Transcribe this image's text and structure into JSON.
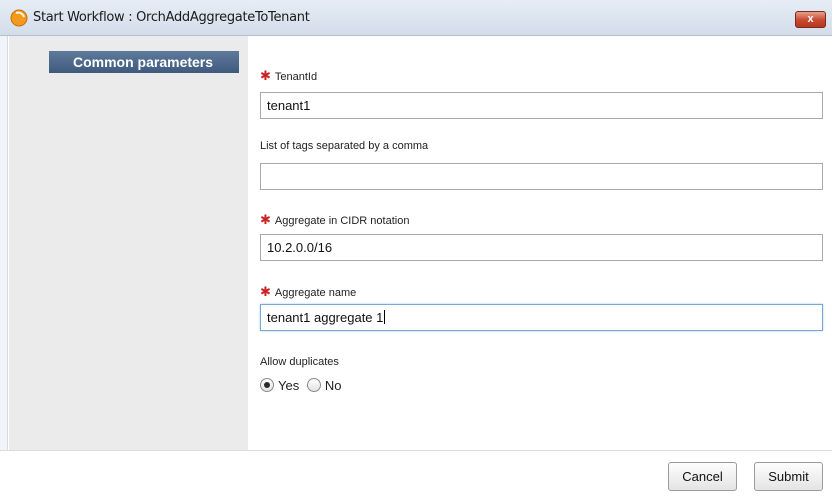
{
  "window": {
    "title": "Start Workflow : OrchAddAggregateToTenant",
    "close_label": "x"
  },
  "sidebar": {
    "active_tab": "Common parameters"
  },
  "fields": [
    {
      "label": "TenantId",
      "required": true,
      "value": "tenant1"
    },
    {
      "label": "List of tags separated by a comma",
      "required": false,
      "value": ""
    },
    {
      "label": "Aggregate in CIDR notation",
      "required": true,
      "value": "10.2.0.0/16"
    },
    {
      "label": "Aggregate name",
      "required": true,
      "value": "tenant1 aggregate 1",
      "focused": true
    }
  ],
  "allow_duplicates": {
    "label": "Allow duplicates",
    "options": [
      "Yes",
      "No"
    ],
    "selected": "Yes"
  },
  "required_marker": "✱",
  "buttons": {
    "cancel": "Cancel",
    "submit": "Submit"
  },
  "colors": {
    "tab_background": "#4a6587",
    "required_star": "#cc2222",
    "close_button": "#c8462e"
  }
}
